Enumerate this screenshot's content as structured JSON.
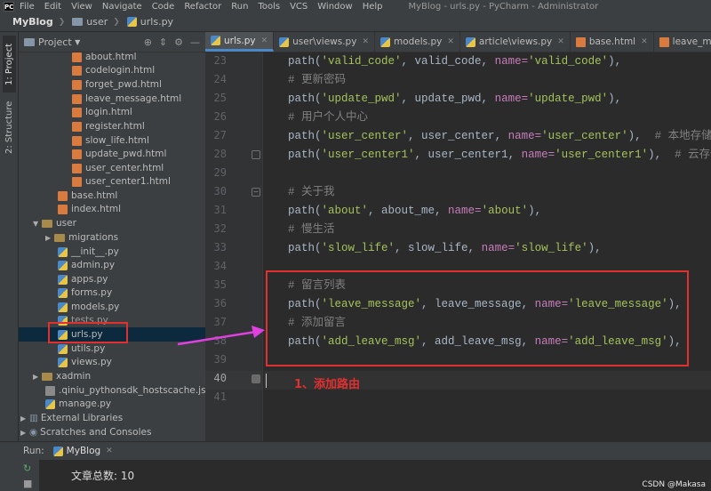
{
  "menubar": {
    "logo": "PC",
    "items": [
      "File",
      "Edit",
      "View",
      "Navigate",
      "Code",
      "Refactor",
      "Run",
      "Tools",
      "VCS",
      "Window",
      "Help"
    ],
    "window_title": "MyBlog - urls.py - PyCharm - Administrator"
  },
  "breadcrumb": [
    "MyBlog",
    "user",
    "urls.py"
  ],
  "sidebar": {
    "tabs": [
      "1: Project",
      "2: Structure"
    ]
  },
  "project_panel": {
    "title": "Project",
    "tree": [
      {
        "label": "about.html",
        "type": "html"
      },
      {
        "label": "codelogin.html",
        "type": "html"
      },
      {
        "label": "forget_pwd.html",
        "type": "html"
      },
      {
        "label": "leave_message.html",
        "type": "html"
      },
      {
        "label": "login.html",
        "type": "html"
      },
      {
        "label": "register.html",
        "type": "html"
      },
      {
        "label": "slow_life.html",
        "type": "html"
      },
      {
        "label": "update_pwd.html",
        "type": "html"
      },
      {
        "label": "user_center.html",
        "type": "html"
      },
      {
        "label": "user_center1.html",
        "type": "html"
      },
      {
        "label": "base.html",
        "type": "html"
      },
      {
        "label": "index.html",
        "type": "html"
      },
      {
        "label": "user",
        "type": "folder"
      },
      {
        "label": "migrations",
        "type": "folder"
      },
      {
        "label": "__init__.py",
        "type": "py"
      },
      {
        "label": "admin.py",
        "type": "py"
      },
      {
        "label": "apps.py",
        "type": "py"
      },
      {
        "label": "forms.py",
        "type": "py"
      },
      {
        "label": "models.py",
        "type": "py"
      },
      {
        "label": "tests.py",
        "type": "py"
      },
      {
        "label": "urls.py",
        "type": "py"
      },
      {
        "label": "utils.py",
        "type": "py"
      },
      {
        "label": "views.py",
        "type": "py"
      },
      {
        "label": "xadmin",
        "type": "folder"
      },
      {
        "label": ".qiniu_pythonsdk_hostscache.json",
        "type": "file"
      },
      {
        "label": "manage.py",
        "type": "py"
      },
      {
        "label": "External Libraries",
        "type": "lib"
      },
      {
        "label": "Scratches and Consoles",
        "type": "lib"
      }
    ]
  },
  "tabs": [
    {
      "label": "urls.py",
      "active": true
    },
    {
      "label": "user\\views.py",
      "active": false
    },
    {
      "label": "models.py",
      "active": false
    },
    {
      "label": "article\\views.py",
      "active": false
    },
    {
      "label": "base.html",
      "active": false
    },
    {
      "label": "leave_message.html",
      "active": false
    }
  ],
  "editor": {
    "line_numbers": [
      "23",
      "24",
      "25",
      "26",
      "27",
      "28",
      "29",
      "30",
      "31",
      "32",
      "33",
      "34",
      "35",
      "36",
      "37",
      "38",
      "39",
      "40",
      "41"
    ],
    "lines": {
      "l23": {
        "a": "path(",
        "s1": "'valid_code'",
        "b": ", valid_code, ",
        "k": "name=",
        "s2": "'valid_code'",
        "c": "),"
      },
      "l24": {
        "cmt": "# 更新密码"
      },
      "l25": {
        "a": "path(",
        "s1": "'update_pwd'",
        "b": ", update_pwd, ",
        "k": "name=",
        "s2": "'update_pwd'",
        "c": "),"
      },
      "l26": {
        "cmt": "# 用户个人中心"
      },
      "l27": {
        "a": "path(",
        "s1": "'user_center'",
        "b": ", user_center, ",
        "k": "name=",
        "s2": "'user_center'",
        "c": "),  ",
        "cmt": "# 本地存储"
      },
      "l28": {
        "a": "path(",
        "s1": "'user_center1'",
        "b": ", user_center1, ",
        "k": "name=",
        "s2": "'user_center1'",
        "c": "),  ",
        "cmt": "# 云存储"
      },
      "l30": {
        "cmt": "# 关于我"
      },
      "l31": {
        "a": "path(",
        "s1": "'about'",
        "b": ", about_me, ",
        "k": "name=",
        "s2": "'about'",
        "c": "),"
      },
      "l32": {
        "cmt": "# 慢生活"
      },
      "l33": {
        "a": "path(",
        "s1": "'slow_life'",
        "b": ", slow_life, ",
        "k": "name=",
        "s2": "'slow_life'",
        "c": "),"
      },
      "l35": {
        "cmt": "# 留言列表"
      },
      "l36": {
        "a": "path(",
        "s1": "'leave_message'",
        "b": ", leave_message, ",
        "k": "name=",
        "s2": "'leave_message'",
        "c": "),"
      },
      "l37": {
        "cmt": "# 添加留言"
      },
      "l38": {
        "a": "path(",
        "s1": "'add_leave_msg'",
        "b": ", add_leave_msg, ",
        "k": "name=",
        "s2": "'add_leave_msg'",
        "c": "),"
      }
    },
    "annotation": "1、添加路由"
  },
  "run_panel": {
    "label": "Run:",
    "tab": "MyBlog",
    "output_line": "文章总数:  10"
  },
  "watermark": "CSDN @Makasa",
  "colors": {
    "highlight_box": "#e03030",
    "arrow": "#e040e0",
    "string": "#a5c25c",
    "keyword_arg": "#aa4926"
  }
}
